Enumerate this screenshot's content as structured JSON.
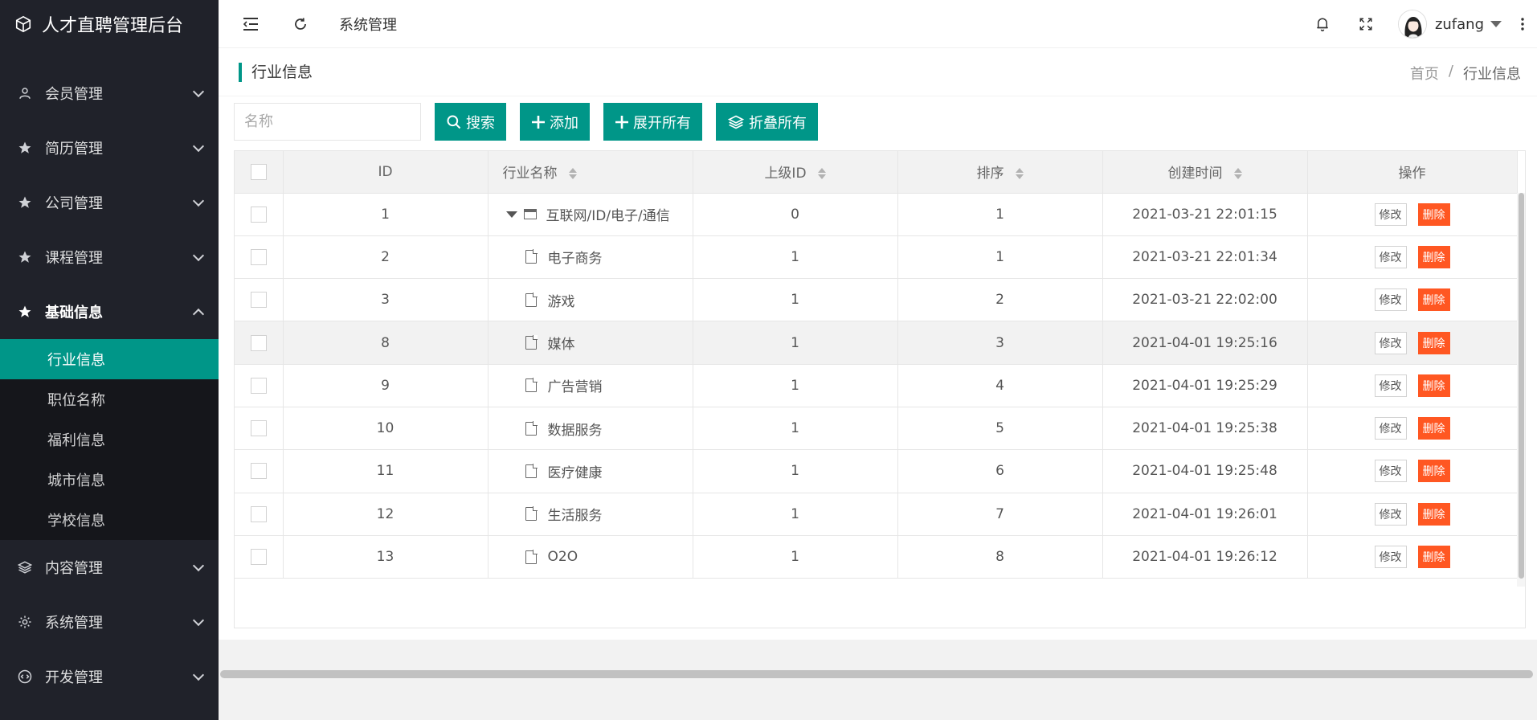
{
  "app": {
    "title": "人才直聘管理后台"
  },
  "sidebar": {
    "items": [
      {
        "label": "会员管理",
        "icon": "user-icon"
      },
      {
        "label": "简历管理",
        "icon": "star-icon"
      },
      {
        "label": "公司管理",
        "icon": "star-icon"
      },
      {
        "label": "课程管理",
        "icon": "star-icon"
      },
      {
        "label": "基础信息",
        "icon": "star-icon",
        "expanded": true
      },
      {
        "label": "内容管理",
        "icon": "layers-icon"
      },
      {
        "label": "系统管理",
        "icon": "gear-icon"
      },
      {
        "label": "开发管理",
        "icon": "code-icon"
      }
    ],
    "submenu": [
      {
        "label": "行业信息",
        "active": true
      },
      {
        "label": "职位名称"
      },
      {
        "label": "福利信息"
      },
      {
        "label": "城市信息"
      },
      {
        "label": "学校信息"
      }
    ]
  },
  "header": {
    "title": "系统管理",
    "user_name": "zufang"
  },
  "page": {
    "title": "行业信息",
    "breadcrumb": [
      "首页",
      "/",
      "行业信息"
    ]
  },
  "toolbar": {
    "search_placeholder": "名称",
    "search_label": "搜索",
    "add_label": "添加",
    "expand_label": "展开所有",
    "collapse_label": "折叠所有"
  },
  "table": {
    "headers": {
      "id": "ID",
      "name": "行业名称",
      "parent": "上级ID",
      "sort": "排序",
      "created": "创建时间",
      "ops": "操作"
    },
    "edit_label": "修改",
    "delete_label": "删除",
    "rows": [
      {
        "id": "1",
        "name": "互联网/ID/电子/通信",
        "parent": "0",
        "sort": "1",
        "created": "2021-03-21 22:01:15",
        "folder": true
      },
      {
        "id": "2",
        "name": "电子商务",
        "parent": "1",
        "sort": "1",
        "created": "2021-03-21 22:01:34"
      },
      {
        "id": "3",
        "name": "游戏",
        "parent": "1",
        "sort": "2",
        "created": "2021-03-21 22:02:00"
      },
      {
        "id": "8",
        "name": "媒体",
        "parent": "1",
        "sort": "3",
        "created": "2021-04-01 19:25:16",
        "highlight": true
      },
      {
        "id": "9",
        "name": "广告营销",
        "parent": "1",
        "sort": "4",
        "created": "2021-04-01 19:25:29"
      },
      {
        "id": "10",
        "name": "数据服务",
        "parent": "1",
        "sort": "5",
        "created": "2021-04-01 19:25:38"
      },
      {
        "id": "11",
        "name": "医疗健康",
        "parent": "1",
        "sort": "6",
        "created": "2021-04-01 19:25:48"
      },
      {
        "id": "12",
        "name": "生活服务",
        "parent": "1",
        "sort": "7",
        "created": "2021-04-01 19:26:01"
      },
      {
        "id": "13",
        "name": "O2O",
        "parent": "1",
        "sort": "8",
        "created": "2021-04-01 19:26:12"
      }
    ]
  },
  "colors": {
    "primary": "#009688",
    "danger": "#ff5722",
    "sidebar_bg": "#20222a"
  }
}
